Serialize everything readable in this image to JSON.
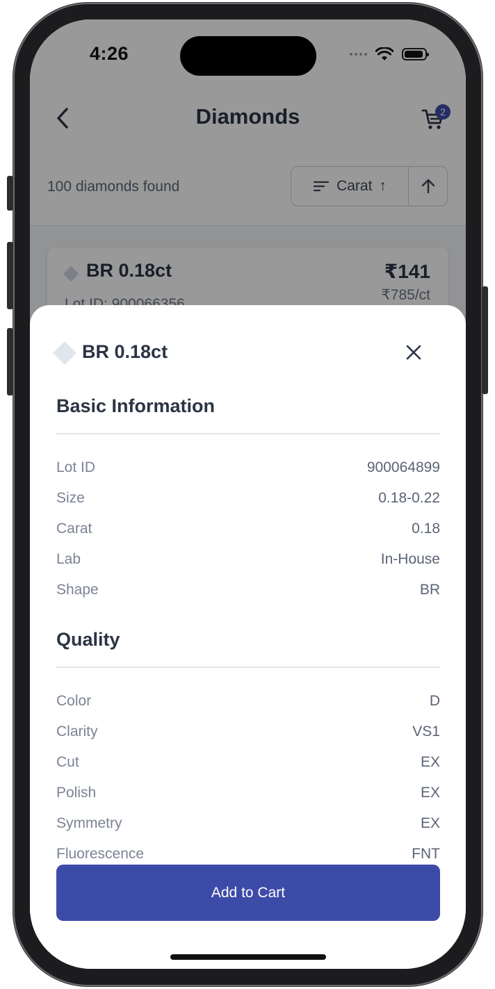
{
  "status_bar": {
    "time": "4:26"
  },
  "nav": {
    "title": "Diamonds",
    "cart_count": "2"
  },
  "results": {
    "count_text": "100 diamonds found",
    "sort_label": "Carat",
    "sort_arrow": "↑"
  },
  "background_card": {
    "title": "BR 0.18ct",
    "lot_text": "Lot ID: 900066356",
    "price": "₹141",
    "price_per_ct": "₹785/ct"
  },
  "sheet": {
    "title": "BR 0.18ct",
    "sections": {
      "basic": {
        "title": "Basic Information",
        "rows": [
          {
            "label": "Lot ID",
            "value": "900064899"
          },
          {
            "label": "Size",
            "value": "0.18-0.22"
          },
          {
            "label": "Carat",
            "value": "0.18"
          },
          {
            "label": "Lab",
            "value": "In-House"
          },
          {
            "label": "Shape",
            "value": "BR"
          }
        ]
      },
      "quality": {
        "title": "Quality",
        "rows": [
          {
            "label": "Color",
            "value": "D"
          },
          {
            "label": "Clarity",
            "value": "VS1"
          },
          {
            "label": "Cut",
            "value": "EX"
          },
          {
            "label": "Polish",
            "value": "EX"
          },
          {
            "label": "Symmetry",
            "value": "EX"
          },
          {
            "label": "Fluorescence",
            "value": "FNT"
          }
        ]
      }
    },
    "add_to_cart_label": "Add to Cart"
  },
  "colors": {
    "accent": "#3d4ba8",
    "text_primary": "#2b3444",
    "text_secondary": "#7b8394"
  }
}
